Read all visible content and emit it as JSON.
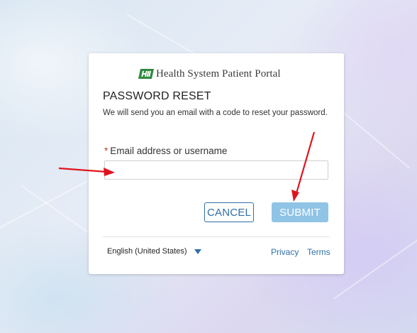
{
  "brand": {
    "logo_text": "HH",
    "name": "Health System Patient Portal"
  },
  "reset": {
    "title": "PASSWORD RESET",
    "description": "We will send you an email with a code to reset your password."
  },
  "form": {
    "required_marker": "*",
    "email_label": "Email address or username",
    "email_value": "",
    "email_placeholder": ""
  },
  "buttons": {
    "cancel_label": "CANCEL",
    "submit_label": "SUBMIT"
  },
  "footer": {
    "language": "English (United States)",
    "privacy_label": "Privacy",
    "terms_label": "Terms"
  },
  "colors": {
    "accent": "#2f6fa8",
    "submit_disabled": "#8fc4e6",
    "logo_green": "#2e8b3e",
    "annotation_red": "#e0141e",
    "required": "#c0392b"
  }
}
